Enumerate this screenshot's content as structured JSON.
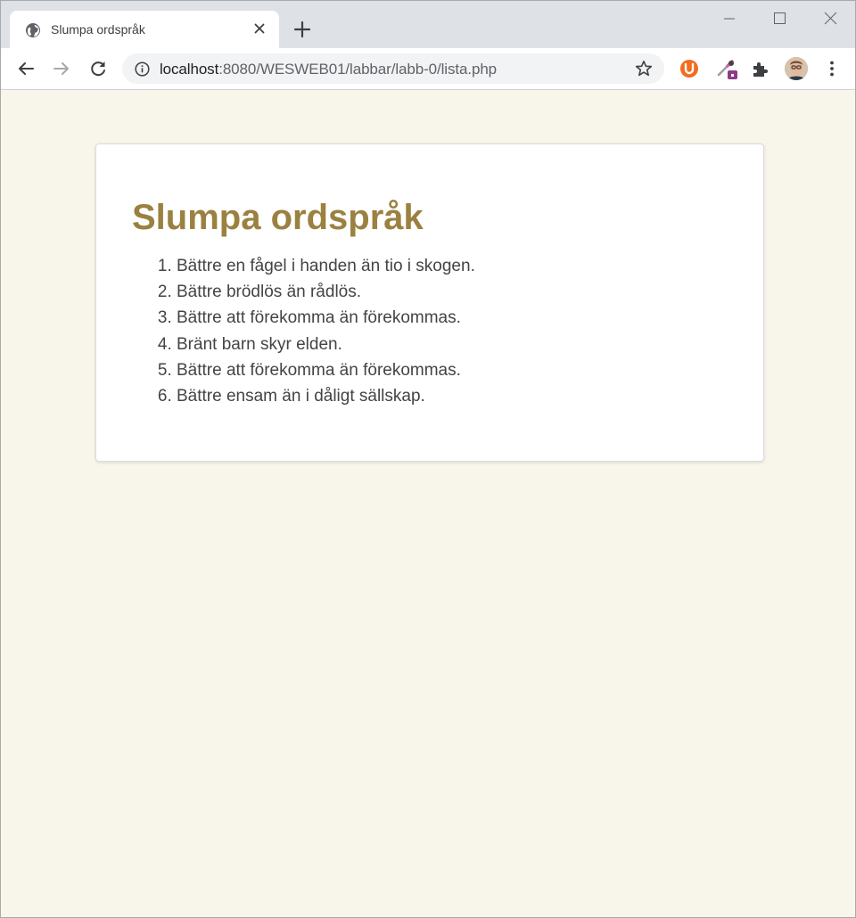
{
  "browser": {
    "tab": {
      "title": "Slumpa ordspråk",
      "favicon": "globe-icon"
    },
    "address_bar": {
      "host": "localhost",
      "path": ":8080/WESWEB01/labbar/labb-0/lista.php"
    },
    "extensions": [
      "ublock-icon",
      "color-picker-extension-icon",
      "puzzle-extensions-icon"
    ],
    "colors": {
      "tabstrip": "#dee1e6",
      "toolbar": "#ffffff",
      "omnibox": "#f1f3f4"
    }
  },
  "page": {
    "heading": "Slumpa ordspråk",
    "proverbs": [
      "Bättre en fågel i handen än tio i skogen.",
      "Bättre brödlös än rådlös.",
      "Bättre att förekomma än förekommas.",
      "Bränt barn skyr elden.",
      "Bättre att förekomma än förekommas.",
      "Bättre ensam än i dåligt sällskap."
    ],
    "colors": {
      "background": "#f8f6eb",
      "card": "#ffffff",
      "heading": "#9b8140",
      "text": "#444444"
    }
  }
}
